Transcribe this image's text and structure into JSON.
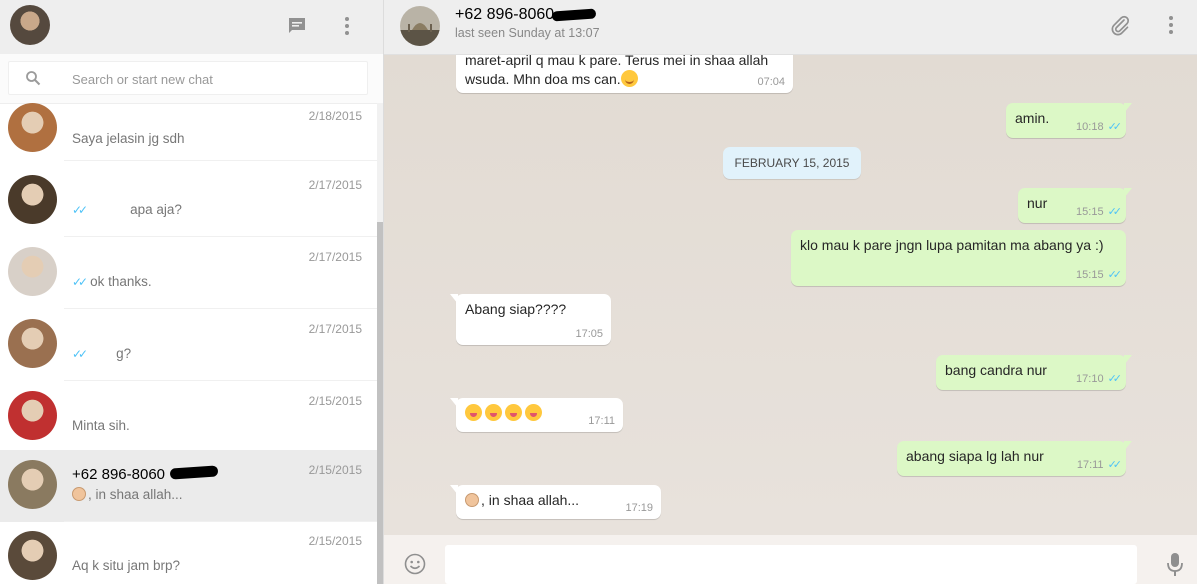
{
  "sidebar": {
    "search": {
      "placeholder": "Search or start new chat"
    },
    "chats": [
      {
        "name": "",
        "date": "2/18/2015",
        "preview": "Saya jelasin jg sdh",
        "ticks": false,
        "emoji": false,
        "active": false,
        "avatar_color": "#b07040"
      },
      {
        "name": "",
        "date": "2/17/2015",
        "preview": "apa aja?",
        "ticks": true,
        "emoji": false,
        "active": false,
        "avatar_color": "#4a3a2a"
      },
      {
        "name": "",
        "date": "2/17/2015",
        "preview": "ok thanks.",
        "ticks": true,
        "emoji": false,
        "active": false,
        "avatar_color": "#d8d0c8"
      },
      {
        "name": "",
        "date": "2/17/2015",
        "preview": "g?",
        "ticks": true,
        "emoji": false,
        "active": false,
        "avatar_color": "#9a7050"
      },
      {
        "name": "",
        "date": "2/15/2015",
        "preview": "Minta sih.",
        "ticks": false,
        "emoji": false,
        "active": false,
        "avatar_color": "#c03030"
      },
      {
        "name": "+62 896-8060",
        "date": "2/15/2015",
        "preview": ", in shaa allah...",
        "ticks": false,
        "emoji": true,
        "active": true,
        "avatar_color": "#8a7a60"
      },
      {
        "name": "",
        "date": "2/15/2015",
        "preview": "Aq k situ jam brp?",
        "ticks": false,
        "emoji": false,
        "active": false,
        "avatar_color": "#5a4a3a"
      }
    ]
  },
  "conversation": {
    "contact_name": "+62 896-8060",
    "last_seen": "last seen Sunday at 13:07",
    "date_divider": "FEBRUARY 15, 2015",
    "messages": [
      {
        "dir": "in",
        "lines": [
          "maret-april q mau k pare. Terus mei in shaa allah",
          "wsuda. Mhn doa ms can."
        ],
        "time": "07:04",
        "smile": true
      },
      {
        "dir": "out",
        "text": "amin.",
        "time": "10:18"
      },
      {
        "dir": "out",
        "text": "nur",
        "time": "15:15"
      },
      {
        "dir": "out",
        "text": "klo mau k pare jngn lupa pamitan ma abang ya :)",
        "time": "15:15"
      },
      {
        "dir": "in",
        "text": "Abang siap????",
        "time": "17:05"
      },
      {
        "dir": "out",
        "text": "bang candra nur",
        "time": "17:10"
      },
      {
        "dir": "in",
        "text": "",
        "time": "17:11",
        "emoji_count": 4
      },
      {
        "dir": "out",
        "text": "abang  siapa lg lah nur",
        "time": "17:11"
      },
      {
        "dir": "in",
        "text": ", in shaa allah...",
        "time": "17:19",
        "thumb": true
      }
    ]
  },
  "compose": {
    "placeholder": ""
  },
  "icons": {
    "new_chat": "message-icon",
    "menu": "kebab-menu-icon",
    "attach": "paperclip-icon",
    "emoji": "smiley-icon",
    "mic": "microphone-icon",
    "search": "magnifier-icon"
  },
  "colors": {
    "outgoing_bubble": "#dcf8c6",
    "incoming_bubble": "#ffffff",
    "read_ticks": "#4fc3f7",
    "chat_background": "#e5ddd5",
    "date_chip": "#e1f2fb"
  }
}
